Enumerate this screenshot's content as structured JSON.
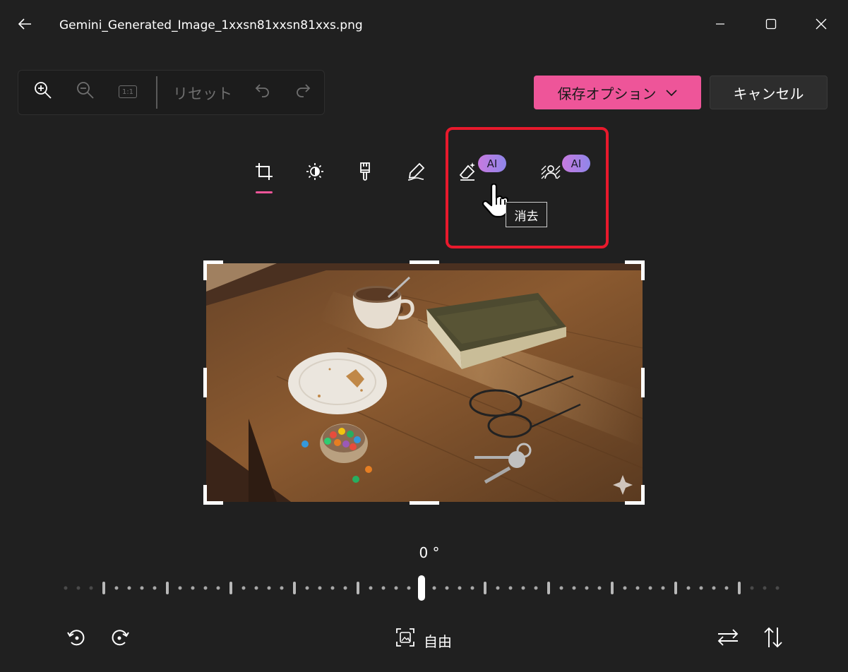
{
  "window": {
    "title": "Gemini_Generated_Image_1xxsn81xxsn81xxs.png",
    "icons": [
      "back-arrow-icon",
      "minimize-icon",
      "maximize-icon",
      "close-icon"
    ]
  },
  "toolbar": {
    "reset_label": "リセット",
    "icons": [
      "zoom-in-icon",
      "zoom-out-icon",
      "actual-size-icon",
      "undo-icon",
      "redo-icon"
    ],
    "actual_size_text": "1:1"
  },
  "actions": {
    "save_label": "保存オプション",
    "cancel_label": "キャンセル"
  },
  "tools": {
    "items": [
      "crop",
      "adjust",
      "filter",
      "markup",
      "erase",
      "background"
    ],
    "ai_badge": "AI",
    "tooltip": "消去"
  },
  "editor": {
    "angle": "0 °",
    "aspect_label": "自由"
  },
  "colors": {
    "accent": "#ee5599",
    "highlight": "#e8192c",
    "background": "#202020"
  }
}
